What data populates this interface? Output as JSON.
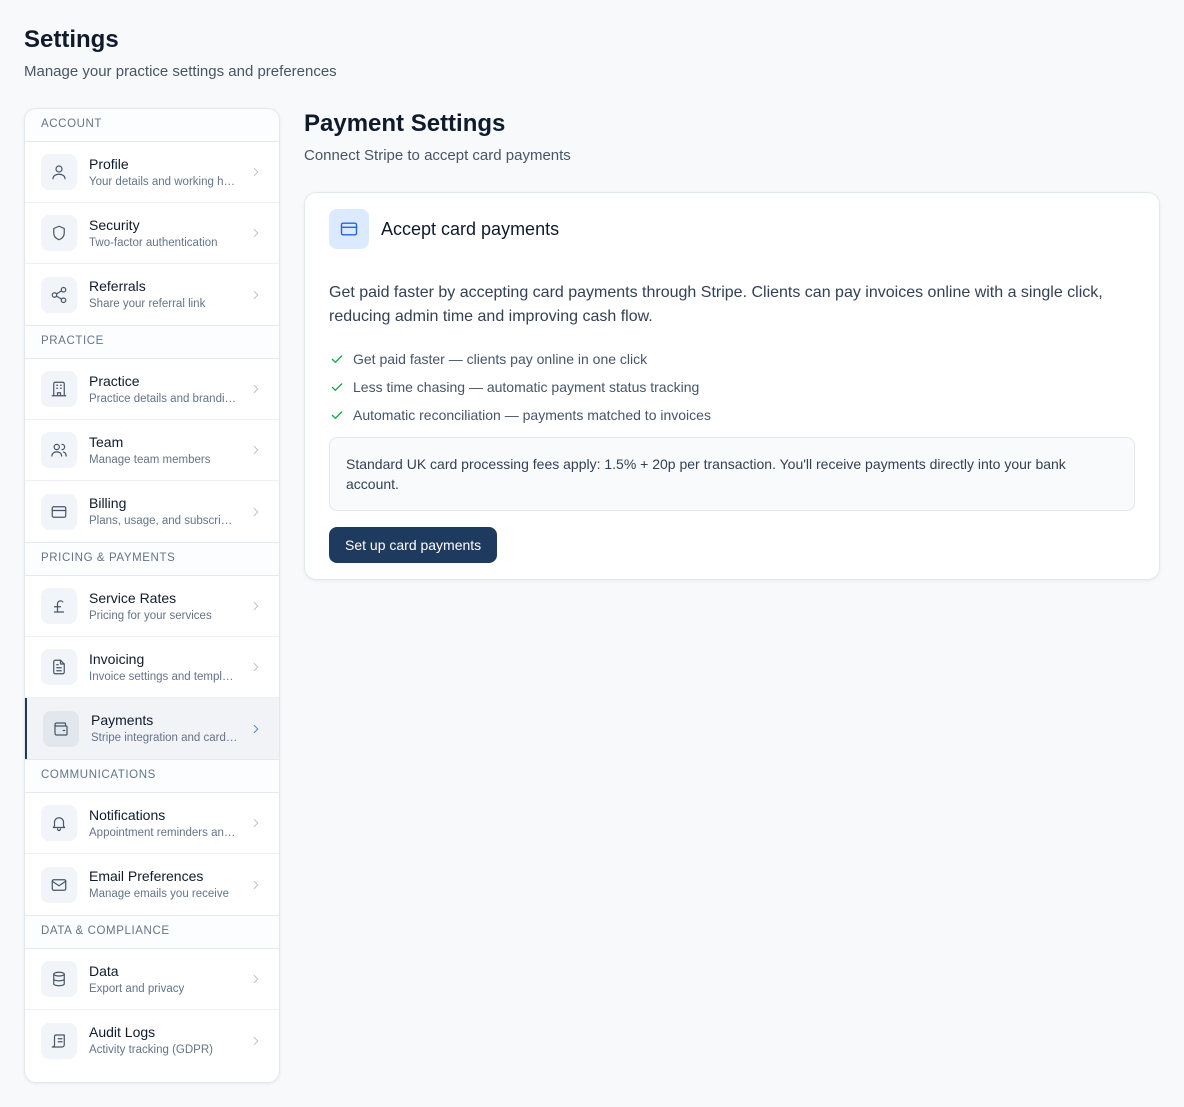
{
  "header": {
    "title": "Settings",
    "subtitle": "Manage your practice settings and preferences"
  },
  "sidebar": {
    "sections": [
      {
        "title": "ACCOUNT",
        "items": [
          {
            "label": "Profile",
            "description": "Your details and working hours",
            "icon": "user-icon"
          },
          {
            "label": "Security",
            "description": "Two-factor authentication",
            "icon": "shield-icon"
          },
          {
            "label": "Referrals",
            "description": "Share your referral link",
            "icon": "share-icon"
          }
        ]
      },
      {
        "title": "PRACTICE",
        "items": [
          {
            "label": "Practice",
            "description": "Practice details and branding",
            "icon": "building-icon"
          },
          {
            "label": "Team",
            "description": "Manage team members",
            "icon": "users-icon"
          },
          {
            "label": "Billing",
            "description": "Plans, usage, and subscription",
            "icon": "credit-card-icon"
          }
        ]
      },
      {
        "title": "PRICING & PAYMENTS",
        "items": [
          {
            "label": "Service Rates",
            "description": "Pricing for your services",
            "icon": "pound-icon"
          },
          {
            "label": "Invoicing",
            "description": "Invoice settings and templates",
            "icon": "document-icon"
          },
          {
            "label": "Payments",
            "description": "Stripe integration and card payments",
            "icon": "wallet-icon",
            "active": true
          }
        ]
      },
      {
        "title": "COMMUNICATIONS",
        "items": [
          {
            "label": "Notifications",
            "description": "Appointment reminders and alerts",
            "icon": "bell-icon"
          },
          {
            "label": "Email Preferences",
            "description": "Manage emails you receive",
            "icon": "mail-icon"
          }
        ]
      },
      {
        "title": "DATA & COMPLIANCE",
        "items": [
          {
            "label": "Data",
            "description": "Export and privacy",
            "icon": "database-icon"
          },
          {
            "label": "Audit Logs",
            "description": "Activity tracking (GDPR)",
            "icon": "scroll-icon"
          }
        ]
      }
    ]
  },
  "main": {
    "title": "Payment Settings",
    "subtitle": "Connect Stripe to accept card payments",
    "card": {
      "title": "Accept card payments",
      "icon": "credit-card-icon",
      "description": "Get paid faster by accepting card payments through Stripe. Clients can pay invoices online with a single click, reducing admin time and improving cash flow.",
      "benefits": [
        "Get paid faster — clients pay online in one click",
        "Less time chasing — automatic payment status tracking",
        "Automatic reconciliation — payments matched to invoices"
      ],
      "fee_note": "Standard UK card processing fees apply: 1.5% + 20p per transaction. You'll receive payments directly into your bank account.",
      "button_label": "Set up card payments"
    }
  },
  "colors": {
    "accent": "#1e3a5f",
    "active_chevron": "#3b82f6",
    "check": "#16a34a",
    "card_icon_bg": "#dbeafe"
  }
}
